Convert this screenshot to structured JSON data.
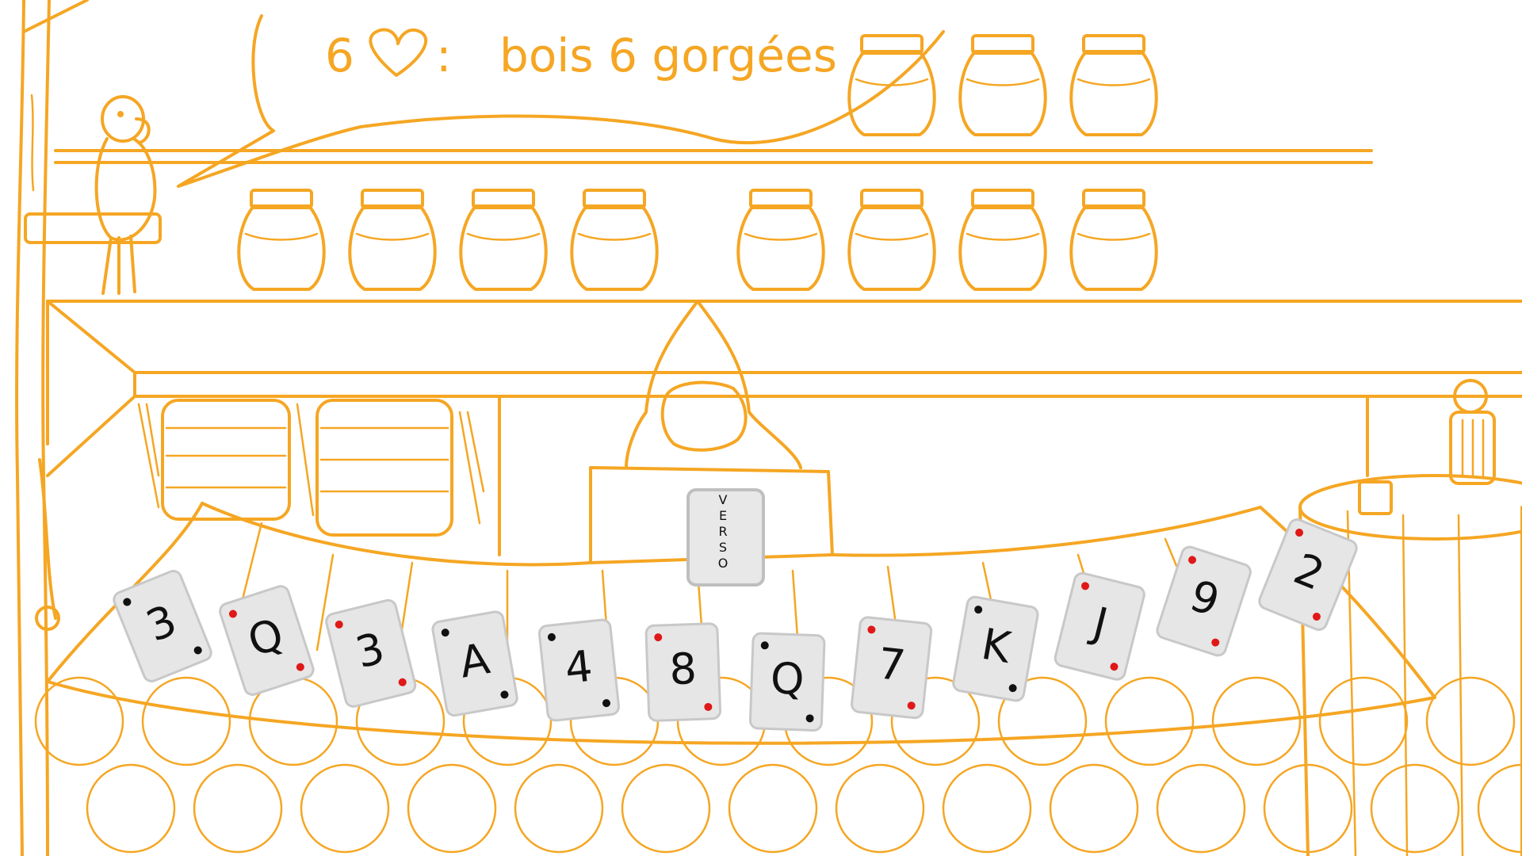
{
  "colors": {
    "ink": "#f5a623",
    "card": "#e6e6e6",
    "card_edge": "#c8c8c8",
    "pip_red": "#e01818",
    "pip_black": "#111111"
  },
  "speech_bubble": {
    "count": "6",
    "suit_icon": "heart-outline-icon",
    "separator": ":",
    "rule_text": "bois 6 gorgées"
  },
  "deck": {
    "label": "VERSO",
    "letters": [
      "V",
      "E",
      "R",
      "S",
      "O"
    ]
  },
  "cards": [
    {
      "rank": "3",
      "suit_color": "black"
    },
    {
      "rank": "Q",
      "suit_color": "red"
    },
    {
      "rank": "3",
      "suit_color": "red"
    },
    {
      "rank": "A",
      "suit_color": "black"
    },
    {
      "rank": "4",
      "suit_color": "black"
    },
    {
      "rank": "8",
      "suit_color": "red"
    },
    {
      "rank": "Q",
      "suit_color": "black"
    },
    {
      "rank": "7",
      "suit_color": "red"
    },
    {
      "rank": "K",
      "suit_color": "black"
    },
    {
      "rank": "J",
      "suit_color": "red"
    },
    {
      "rank": "9",
      "suit_color": "red"
    },
    {
      "rank": "2",
      "suit_color": "red"
    }
  ]
}
